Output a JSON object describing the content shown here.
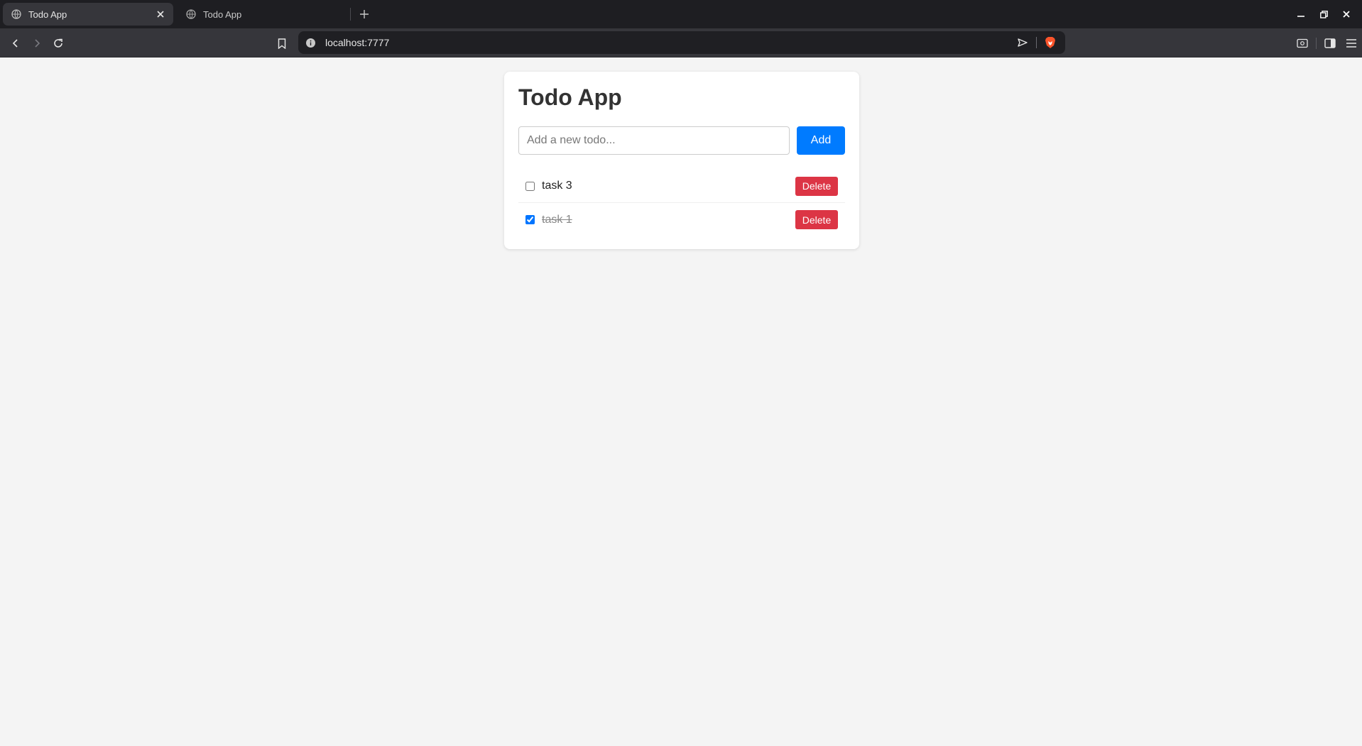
{
  "browser": {
    "tabs": [
      {
        "title": "Todo App",
        "active": true
      },
      {
        "title": "Todo App",
        "active": false
      }
    ],
    "url": "localhost:7777"
  },
  "app": {
    "title": "Todo App",
    "input": {
      "value": "",
      "placeholder": "Add a new todo..."
    },
    "add_label": "Add",
    "todos": [
      {
        "text": "task 3",
        "done": false,
        "delete_label": "Delete"
      },
      {
        "text": "task 1",
        "done": true,
        "delete_label": "Delete"
      }
    ]
  },
  "colors": {
    "primary": "#007bff",
    "danger": "#dc3545",
    "page_bg": "#f4f4f4",
    "chrome_dark": "#1e1e22",
    "brave_orange": "#fb542b"
  }
}
